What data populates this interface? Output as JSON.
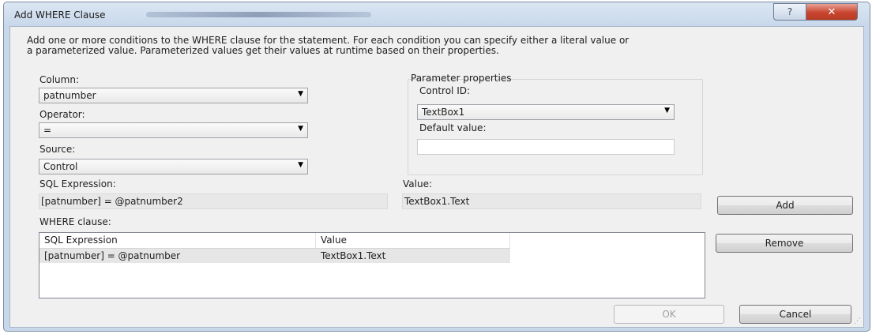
{
  "window": {
    "title": "Add WHERE Clause",
    "help_label": "?",
    "close_label": "✕"
  },
  "description": "Add one or more conditions to the WHERE clause for the statement. For each condition you can specify either a literal value or\na parameterized value. Parameterized values get their values at runtime based on their properties.",
  "column": {
    "label": "Column:",
    "value": "patnumber"
  },
  "operator": {
    "label": "Operator:",
    "value": "="
  },
  "source": {
    "label": "Source:",
    "value": "Control"
  },
  "parameter_properties": {
    "group_label": "Parameter properties",
    "control_id_label": "Control ID:",
    "control_id_value": "TextBox1",
    "default_value_label": "Default value:",
    "default_value": ""
  },
  "sql_expression": {
    "label": "SQL Expression:",
    "value": "[patnumber] = @patnumber2"
  },
  "value": {
    "label": "Value:",
    "value": "TextBox1.Text"
  },
  "where_clause": {
    "label": "WHERE clause:",
    "columns": [
      "SQL Expression",
      "Value"
    ],
    "rows": [
      {
        "sql_expression": "[patnumber] = @patnumber",
        "value": "TextBox1.Text"
      }
    ]
  },
  "buttons": {
    "add": "Add",
    "remove": "Remove",
    "ok": "OK",
    "cancel": "Cancel"
  }
}
